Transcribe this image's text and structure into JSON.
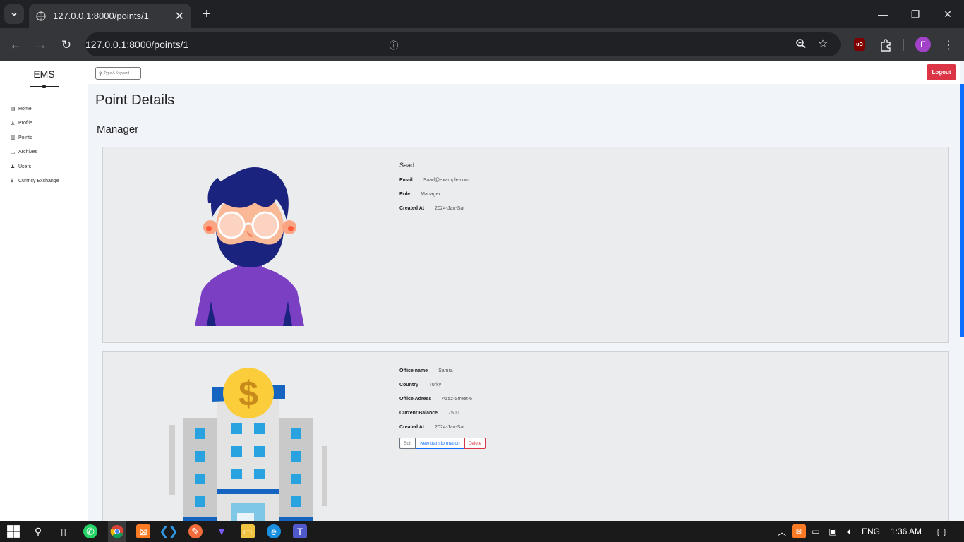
{
  "browser": {
    "tab_title": "127.0.0.1:8000/points/1",
    "url": "127.0.0.1:8000/points/1",
    "profile_initial": "E",
    "ublock_label": "uO"
  },
  "app": {
    "brand": "EMS",
    "search_placeholder": "Type A Keyword",
    "logout_label": "Logout",
    "nav": [
      {
        "label": "Home",
        "icon": "chart-icon"
      },
      {
        "label": "Profile",
        "icon": "user-icon"
      },
      {
        "label": "Points",
        "icon": "bank-icon"
      },
      {
        "label": "Archives",
        "icon": "folder-icon"
      },
      {
        "label": "Users",
        "icon": "users-icon"
      },
      {
        "label": "Currncy Exchange",
        "icon": "dollar-icon"
      }
    ]
  },
  "page": {
    "title": "Point Details",
    "section": "Manager"
  },
  "manager": {
    "name": "Saad",
    "rows": [
      {
        "label": "Email",
        "value": "Saad@example.com"
      },
      {
        "label": "Role",
        "value": "Manager"
      },
      {
        "label": "Created At",
        "value": "2024-Jan-Sat"
      }
    ]
  },
  "office": {
    "rows": [
      {
        "label": "Office name",
        "value": "Samra"
      },
      {
        "label": "Country",
        "value": "Turky"
      },
      {
        "label": "Office Adress",
        "value": "Azaz-Street-6"
      },
      {
        "label": "Current Balance",
        "value": "7500"
      },
      {
        "label": "Created At",
        "value": "2024-Jan-Sat"
      }
    ],
    "actions": {
      "edit": "Edit",
      "new": "New transformation",
      "delete": "Delete"
    }
  },
  "taskbar": {
    "language": "ENG",
    "time": "1:36 AM"
  },
  "colors": {
    "accent": "#0d6efd",
    "danger": "#dc3545",
    "page_bg": "#f1f4f9",
    "card_bg": "#ebecee"
  }
}
